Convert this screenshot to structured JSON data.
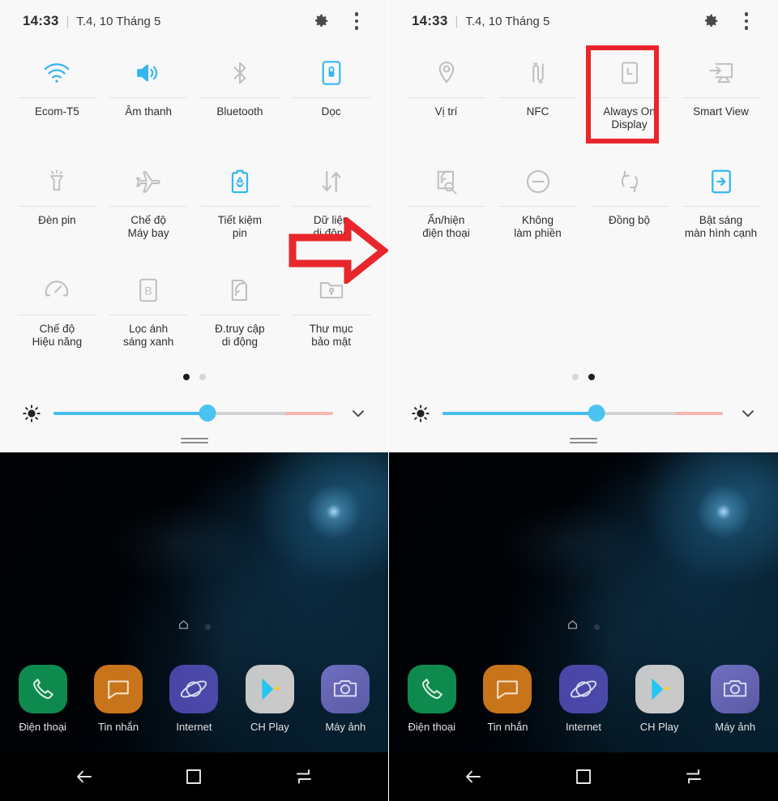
{
  "status_bar": {
    "time": "14:33",
    "separator": "|",
    "date": "T.4, 10 Tháng 5",
    "settings_icon": "gear-icon",
    "menu_icon": "more-vertical-icon"
  },
  "colors": {
    "accent_blue": "#36b6ef",
    "annotation_red": "#e8262b",
    "panel_bg": "#f8f8f8",
    "inactive_icon": "#bfbfbf"
  },
  "left_panel": {
    "page": 1,
    "page_count": 2,
    "tiles": [
      {
        "label": "Ecom-T5",
        "icon": "wifi-icon",
        "state": "on"
      },
      {
        "label": "Âm thanh",
        "icon": "sound-icon",
        "state": "on"
      },
      {
        "label": "Bluetooth",
        "icon": "bluetooth-icon",
        "state": "off"
      },
      {
        "label": "Dọc",
        "icon": "rotation-lock-icon",
        "state": "on"
      },
      {
        "label": "Đèn pin",
        "icon": "flashlight-icon",
        "state": "off"
      },
      {
        "label": "Chế độ\nMáy bay",
        "icon": "airplane-icon",
        "state": "off"
      },
      {
        "label": "Tiết kiệm\npin",
        "icon": "battery-saver-icon",
        "state": "on"
      },
      {
        "label": "Dữ liệu\ndi động",
        "icon": "mobile-data-icon",
        "state": "off"
      },
      {
        "label": "Chế độ\nHiệu năng",
        "icon": "performance-mode-icon",
        "state": "off"
      },
      {
        "label": "Lọc ánh\nsáng xanh",
        "icon": "blue-light-filter-icon",
        "state": "off"
      },
      {
        "label": "Đ.truy cập\ndi động",
        "icon": "mobile-hotspot-icon",
        "state": "off"
      },
      {
        "label": "Thư mục\nbảo mật",
        "icon": "secure-folder-icon",
        "state": "off"
      }
    ],
    "brightness": {
      "icon": "brightness-icon",
      "value_percent": 55,
      "expand_icon": "chevron-down-icon"
    }
  },
  "right_panel": {
    "page": 2,
    "page_count": 2,
    "tiles": [
      {
        "label": "Vị trí",
        "icon": "location-pin-icon",
        "state": "off"
      },
      {
        "label": "NFC",
        "icon": "nfc-icon",
        "state": "off"
      },
      {
        "label": "Always On\nDisplay",
        "icon": "always-on-display-icon",
        "state": "off",
        "highlighted": true
      },
      {
        "label": "Smart View",
        "icon": "smart-view-icon",
        "state": "off"
      },
      {
        "label": "Ẩn/hiện\nđiện thoại",
        "icon": "hide-phone-icon",
        "state": "off"
      },
      {
        "label": "Không\nlàm phiền",
        "icon": "do-not-disturb-icon",
        "state": "off"
      },
      {
        "label": "Đồng bộ",
        "icon": "sync-icon",
        "state": "off"
      },
      {
        "label": "Bật sáng\nmàn hình cạnh",
        "icon": "edge-lighting-icon",
        "state": "on"
      }
    ],
    "brightness": {
      "icon": "brightness-icon",
      "value_percent": 55,
      "expand_icon": "chevron-down-icon"
    }
  },
  "home_screen": {
    "page_indicator": {
      "home_icon": "home-icon",
      "dot": "page-dot"
    },
    "dock": [
      {
        "label": "Điện thoại",
        "icon": "phone-icon",
        "bg": "#0e8a4f"
      },
      {
        "label": "Tin nhắn",
        "icon": "messages-icon",
        "bg": "#c8741b"
      },
      {
        "label": "Internet",
        "icon": "internet-icon",
        "bg": "#4a46a8"
      },
      {
        "label": "CH Play",
        "icon": "play-store-icon",
        "bg": "#c9c9c9"
      },
      {
        "label": "Máy ảnh",
        "icon": "camera-icon",
        "bg": "#6a6ab0"
      }
    ],
    "nav_bar": [
      {
        "name": "back-button",
        "icon": "arrow-left-icon"
      },
      {
        "name": "home-button",
        "icon": "square-icon"
      },
      {
        "name": "recents-button",
        "icon": "recents-icon"
      }
    ]
  },
  "annotations": {
    "arrow": {
      "shape": "right-arrow",
      "color": "#e8262b",
      "target": "Dữ liệu di động"
    },
    "rectangle": {
      "shape": "rectangle",
      "color": "#e8262b",
      "target": "Always On Display"
    }
  }
}
